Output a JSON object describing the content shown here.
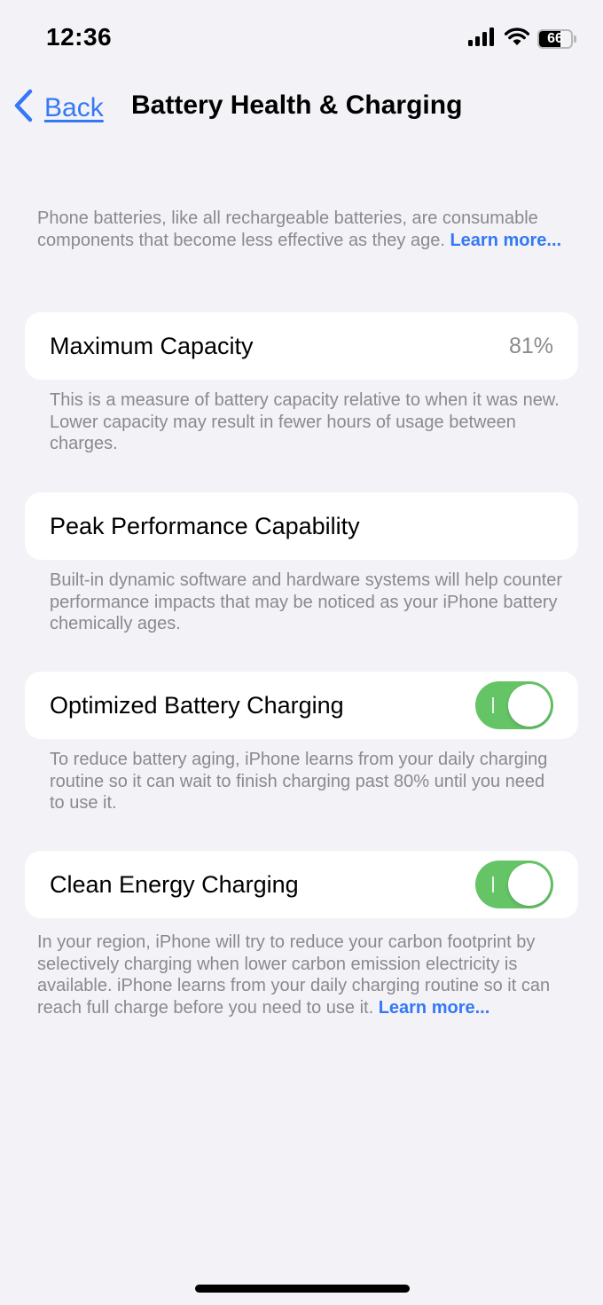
{
  "status_bar": {
    "time": "12:36",
    "battery_level": "66"
  },
  "nav": {
    "back_label": "Back",
    "title": "Battery Health & Charging"
  },
  "intro": {
    "text": "Phone batteries, like all rechargeable batteries, are consumable components that become less effective as they age. ",
    "link": "Learn more..."
  },
  "maximum_capacity": {
    "label": "Maximum Capacity",
    "value": "81%",
    "note": "This is a measure of battery capacity relative to when it was new. Lower capacity may result in fewer hours of usage between charges."
  },
  "peak_performance": {
    "label": "Peak Performance Capability",
    "note": "Built-in dynamic software and hardware systems will help counter performance impacts that may be noticed as your iPhone battery chemically ages."
  },
  "optimized_charging": {
    "label": "Optimized Battery Charging",
    "enabled": true,
    "note": "To reduce battery aging, iPhone learns from your daily charging routine so it can wait to finish charging past 80% until you need to use it."
  },
  "clean_energy": {
    "label": "Clean Energy Charging",
    "enabled": true,
    "note": "In your region, iPhone will try to reduce your carbon footprint by selectively charging when lower carbon emission electricity is available. iPhone learns from your daily charging routine so it can reach full charge before you need to use it. ",
    "link": "Learn more..."
  },
  "colors": {
    "accent": "#3478f6",
    "toggle_on": "#65c466",
    "background": "#f2f2f7",
    "secondary_text": "#8a8a8e"
  }
}
